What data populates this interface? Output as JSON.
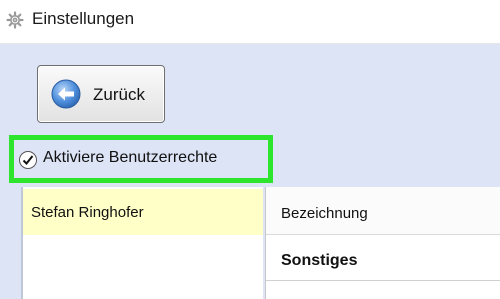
{
  "window": {
    "title": "Einstellungen",
    "icon": "gear-icon"
  },
  "toolbar": {
    "back_label": "Zurück",
    "back_icon": "arrow-left-icon"
  },
  "permissions": {
    "checkbox_label": "Aktiviere Benutzerrechte",
    "checked": true,
    "highlight_color": "#2ee52e"
  },
  "users": {
    "items": [
      {
        "name": "Stefan Ringhofer",
        "selected": true
      }
    ]
  },
  "details": {
    "bezeichnung_label": "Bezeichnung",
    "section_title": "Sonstiges"
  },
  "colors": {
    "main_background": "#dde4f6",
    "selected_user": "#ffffc8",
    "back_icon_blue": "#3a7fd2"
  }
}
